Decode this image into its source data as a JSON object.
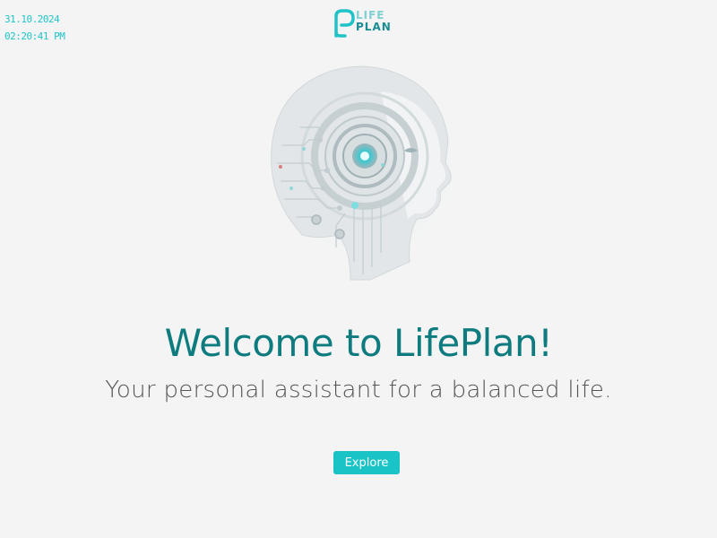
{
  "clock": {
    "date": "31.10.2024",
    "time": "02:20:41 PM"
  },
  "logo": {
    "line1": "LIFE",
    "line2": "PLAN",
    "icon": "lifeplan-logo-icon"
  },
  "hero": {
    "icon": "ai-head-illustration"
  },
  "welcome": {
    "title": "Welcome to LifePlan!",
    "subtitle": "Your personal assistant for a balanced life."
  },
  "actions": {
    "explore_label": "Explore"
  },
  "colors": {
    "accent": "#19c3c6",
    "title": "#0e7b7f",
    "subtitle": "#555555",
    "background": "#f4f4f4"
  }
}
